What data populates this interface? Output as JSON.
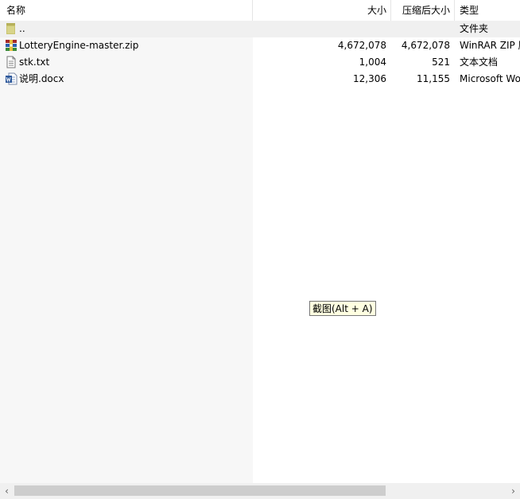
{
  "columns": {
    "name": "名称",
    "size": "大小",
    "packed": "压缩后大小",
    "type": "类型"
  },
  "rows": [
    {
      "name": "..",
      "size": "",
      "packed": "",
      "type": "文件夹",
      "icon": "folder-up-icon"
    },
    {
      "name": "LotteryEngine-master.zip",
      "size": "4,672,078",
      "packed": "4,672,078",
      "type": "WinRAR ZIP 压缩文件",
      "icon": "winrar-archive-icon"
    },
    {
      "name": "stk.txt",
      "size": "1,004",
      "packed": "521",
      "type": "文本文档",
      "icon": "text-file-icon"
    },
    {
      "name": "说明.docx",
      "size": "12,306",
      "packed": "11,155",
      "type": "Microsoft Word 文档",
      "icon": "word-document-icon"
    }
  ],
  "tooltip": "截图(Alt + A)",
  "colors": {
    "header_bg": "#ffffff",
    "name_column_bg": "#f7f7f7",
    "tooltip_bg": "#ffffe1",
    "scroll_thumb": "#cdcdcd"
  }
}
